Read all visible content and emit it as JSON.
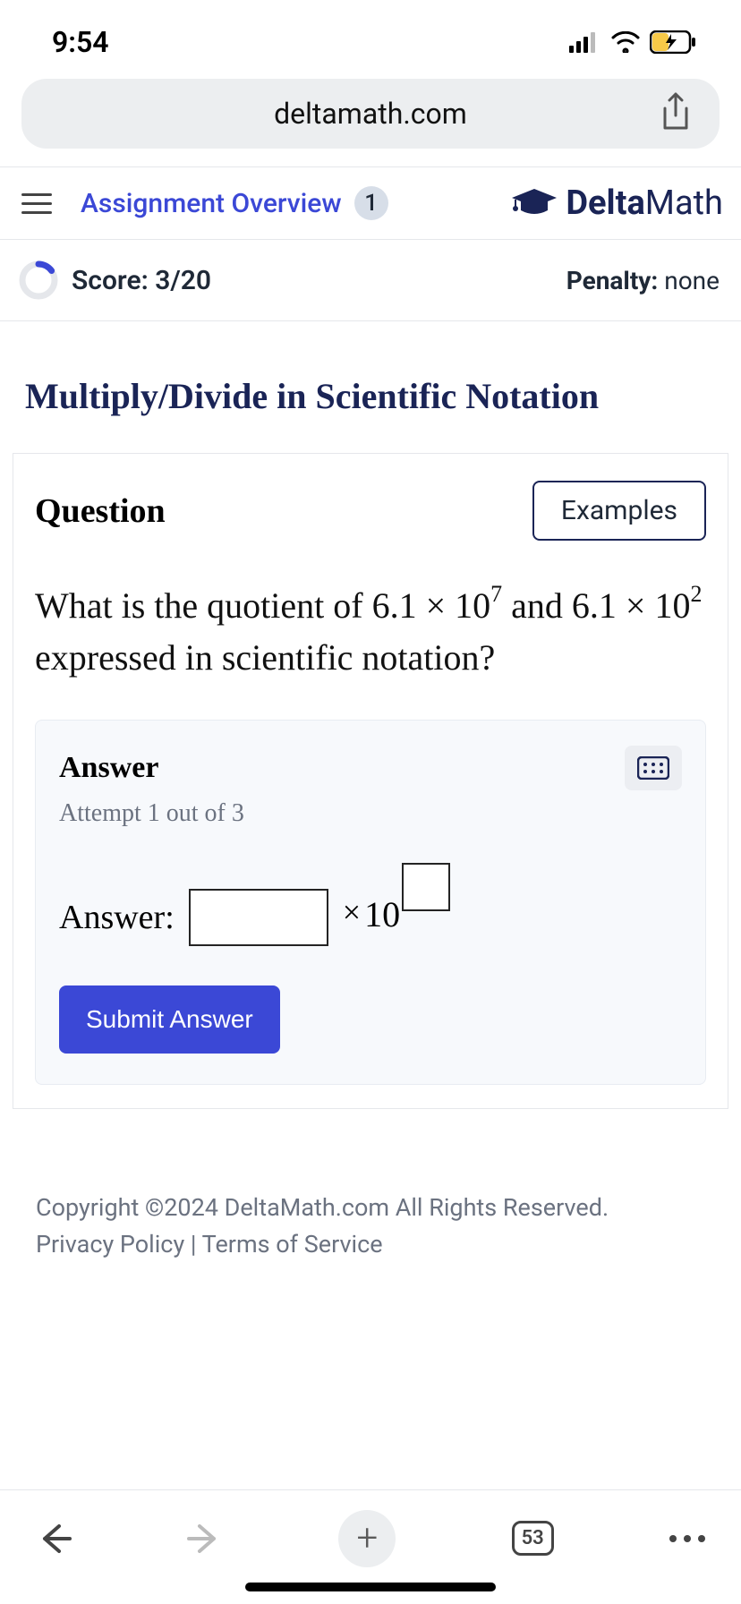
{
  "status": {
    "time": "9:54"
  },
  "browser": {
    "url": "deltamath.com",
    "tab_count": "53"
  },
  "nav": {
    "overview_label": "Assignment Overview",
    "badge": "1",
    "brand_bold": "Delta",
    "brand_light": "Math"
  },
  "score_bar": {
    "score_label": "Score: 3/20",
    "penalty_label": "Penalty:",
    "penalty_value": "none"
  },
  "page_title": "Multiply/Divide in Scientific Notation",
  "question": {
    "heading": "Question",
    "examples_btn": "Examples",
    "text_prefix": "What is the quotient of ",
    "num1_coef": "6.1",
    "num1_exp": "7",
    "mid": " and ",
    "num2_coef": "6.1",
    "num2_exp": "2",
    "text_suffix": " expressed in scientific notation?"
  },
  "answer": {
    "heading": "Answer",
    "attempt": "Attempt 1 out of 3",
    "prefix": "Answer:",
    "times": "×",
    "base": "10",
    "submit": "Submit Answer"
  },
  "footer": {
    "copyright": "Copyright ©2024 DeltaMath.com All Rights Reserved.",
    "links": "Privacy Policy | Terms of Service"
  }
}
